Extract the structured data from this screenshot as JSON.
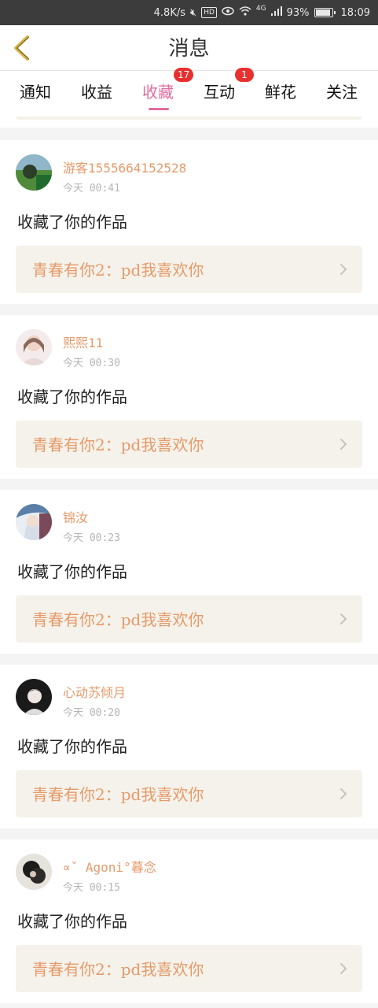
{
  "status_bar": {
    "net_speed": "4.8K/s",
    "hd": "HD",
    "network": "4G",
    "battery": "93%",
    "time": "18:09"
  },
  "header": {
    "title": "消息"
  },
  "tabs": [
    {
      "label": "通知",
      "badge": ""
    },
    {
      "label": "收益",
      "badge": ""
    },
    {
      "label": "收藏",
      "badge": "17",
      "active": true
    },
    {
      "label": "互动",
      "badge": "1"
    },
    {
      "label": "鲜花",
      "badge": ""
    },
    {
      "label": "关注",
      "badge": ""
    }
  ],
  "messages": [
    {
      "username": "游客1555664152528",
      "time": "今天  00:41",
      "action": "收藏了你的作品",
      "work": "青春有你2：pd我喜欢你"
    },
    {
      "username": "熙熙11",
      "time": "今天  00:30",
      "action": "收藏了你的作品",
      "work": "青春有你2：pd我喜欢你"
    },
    {
      "username": "锦汝",
      "time": "今天  00:23",
      "action": "收藏了你的作品",
      "work": "青春有你2：pd我喜欢你"
    },
    {
      "username": "心动苏倾月",
      "time": "今天  00:20",
      "action": "收藏了你的作品",
      "work": "青春有你2：pd我喜欢你"
    },
    {
      "username": "∝ˇ Agoni°暮念",
      "time": "今天  00:15",
      "action": "收藏了你的作品",
      "work": "青春有你2：pd我喜欢你"
    }
  ],
  "colors": {
    "accent_pink": "#e06c9f",
    "username_orange": "#e69a6a",
    "badge_red": "#e8312f",
    "back_arrow": "#d8b54a"
  }
}
